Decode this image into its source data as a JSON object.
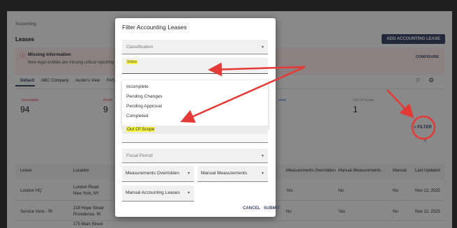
{
  "page": {
    "breadcrumb": "Accounting",
    "title": "Leases",
    "add_button": "ADD ACCOUNTING LEASE",
    "warning_title": "Missing information",
    "warning_text": "New legal entities are missing critical reporting inf",
    "configure": "CONFIGURE",
    "tabs": [
      "Default",
      "ABC Company",
      "Austin's View",
      "FAS"
    ],
    "stats": [
      {
        "label": "Incomplete",
        "value": "94"
      },
      {
        "label": "Pendi",
        "value": "9"
      },
      {
        "label": "oved",
        "value": ""
      },
      {
        "label": "Out Of Scope",
        "value": "1"
      }
    ],
    "filter_label": "FILTER",
    "table_headers": [
      "Lease",
      "Location",
      "Measurements Overridden",
      "Manual Measurements",
      "Manual",
      "Last Updated"
    ],
    "rows": [
      {
        "lease": "London HQ",
        "loc1": "London Road",
        "loc2": "New York, NY",
        "mo": "Yes",
        "mm": "No",
        "manual": "No",
        "updated": "Nov 13, 2025"
      },
      {
        "lease": "Service Vans - RI",
        "loc1": "218 Hope Street",
        "loc2": "Providence, RI",
        "mo": "No",
        "mm": "Yes",
        "manual": "No",
        "updated": "Nov 12, 2025"
      },
      {
        "lease": "",
        "loc1": "170 Main Street",
        "loc2": "",
        "mo": "",
        "mm": "",
        "manual": "",
        "updated": ""
      }
    ]
  },
  "modal": {
    "title": "Filter Accounting Leases",
    "classification_label": "Classification",
    "status_label": "Status",
    "status_options": [
      "Incomplete",
      "Pending Changes",
      "Pending Approval",
      "Completed",
      "Out Of Scope"
    ],
    "fiscal_period_label": "Fiscal Period",
    "measurements_overridden_label": "Measurements Overridden",
    "manual_measurements_label": "Manual Measurements",
    "manual_accounting_leases_label": "Manual Accounting Leases",
    "cancel": "CANCEL",
    "submit": "SUBMIT"
  },
  "colors": {
    "accent": "#3b4a6b",
    "annotation": "#e53935",
    "highlight": "#f5f53a",
    "warning_bg": "#fdecec"
  }
}
